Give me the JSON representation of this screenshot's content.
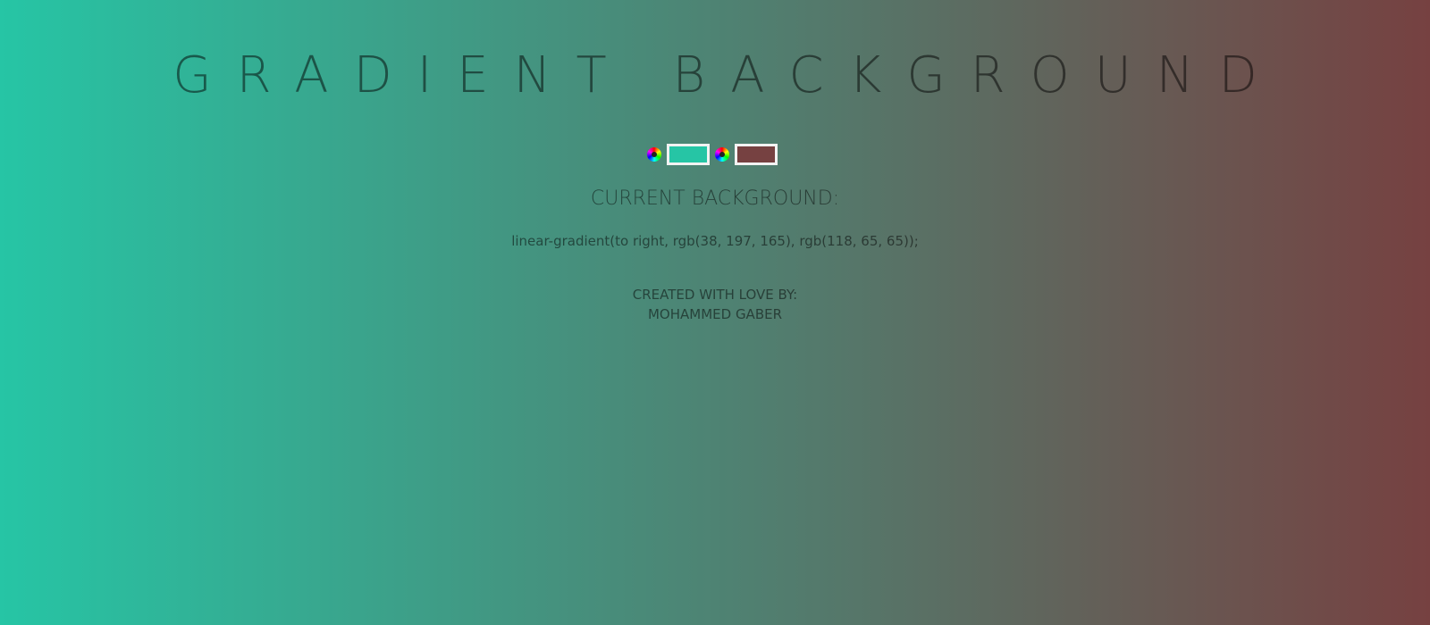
{
  "page": {
    "title": "GRADIENT BACKGROUND",
    "background_start": "#26c5a5",
    "background_end": "#764141"
  },
  "pickers": [
    {
      "icon": "color-wheel-icon",
      "value": "#26c5a5"
    },
    {
      "icon": "color-wheel-icon",
      "value": "#764141"
    }
  ],
  "current": {
    "heading": "CURRENT BACKGROUND:",
    "css": "linear-gradient(to right, rgb(38, 197, 165), rgb(118, 65, 65));"
  },
  "credit": {
    "line1": "CREATED WITH LOVE BY:",
    "line2": "MOHAMMED GABER"
  }
}
